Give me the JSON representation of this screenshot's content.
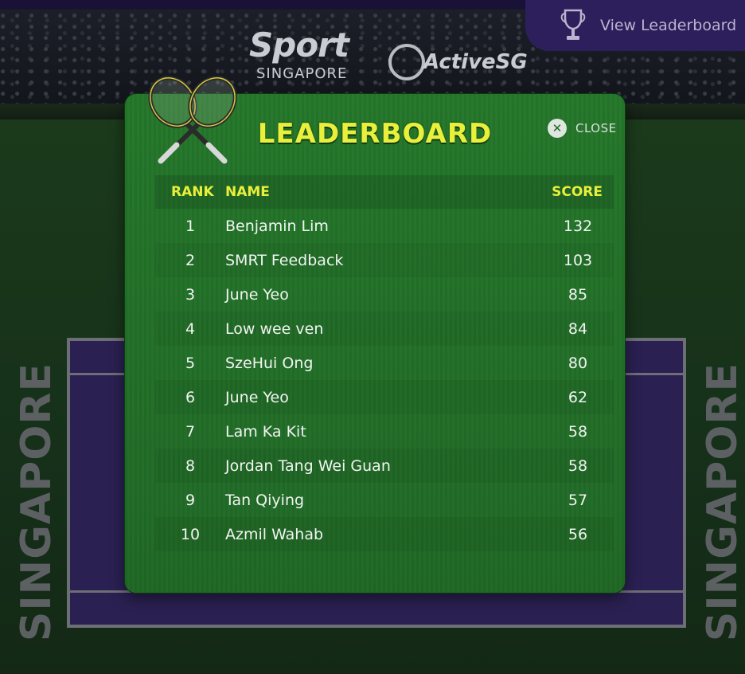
{
  "background": {
    "brand_sport": "Sport",
    "brand_singapore": "SINGAPORE",
    "brand_active": "ActiveSG",
    "side_left_text": "SINGAPORE",
    "side_right_text": "SINGAPORE",
    "court_color": "#2a2052",
    "field_color": "#1b3a1b"
  },
  "top_tab": {
    "label": "View Leaderboard",
    "icon": "trophy-icon"
  },
  "modal": {
    "title": "LEADERBOARD",
    "close_label": "CLOSE",
    "close_icon": "close-icon",
    "decor_icon": "tennis-racquets-icon",
    "accent_color": "#e9ef3b",
    "panel_color": "#22702a",
    "columns": {
      "rank": "RANK",
      "name": "NAME",
      "score": "SCORE"
    },
    "rows": [
      {
        "rank": "1",
        "name": "Benjamin Lim",
        "score": "132"
      },
      {
        "rank": "2",
        "name": "SMRT Feedback",
        "score": "103"
      },
      {
        "rank": "3",
        "name": "June Yeo",
        "score": "85"
      },
      {
        "rank": "4",
        "name": "Low wee ven",
        "score": "84"
      },
      {
        "rank": "5",
        "name": "SzeHui Ong",
        "score": "80"
      },
      {
        "rank": "6",
        "name": "June Yeo",
        "score": "62"
      },
      {
        "rank": "7",
        "name": "Lam Ka Kit",
        "score": "58"
      },
      {
        "rank": "8",
        "name": "Jordan Tang Wei Guan",
        "score": "58"
      },
      {
        "rank": "9",
        "name": "Tan Qiying",
        "score": "57"
      },
      {
        "rank": "10",
        "name": "Azmil Wahab",
        "score": "56"
      }
    ]
  }
}
